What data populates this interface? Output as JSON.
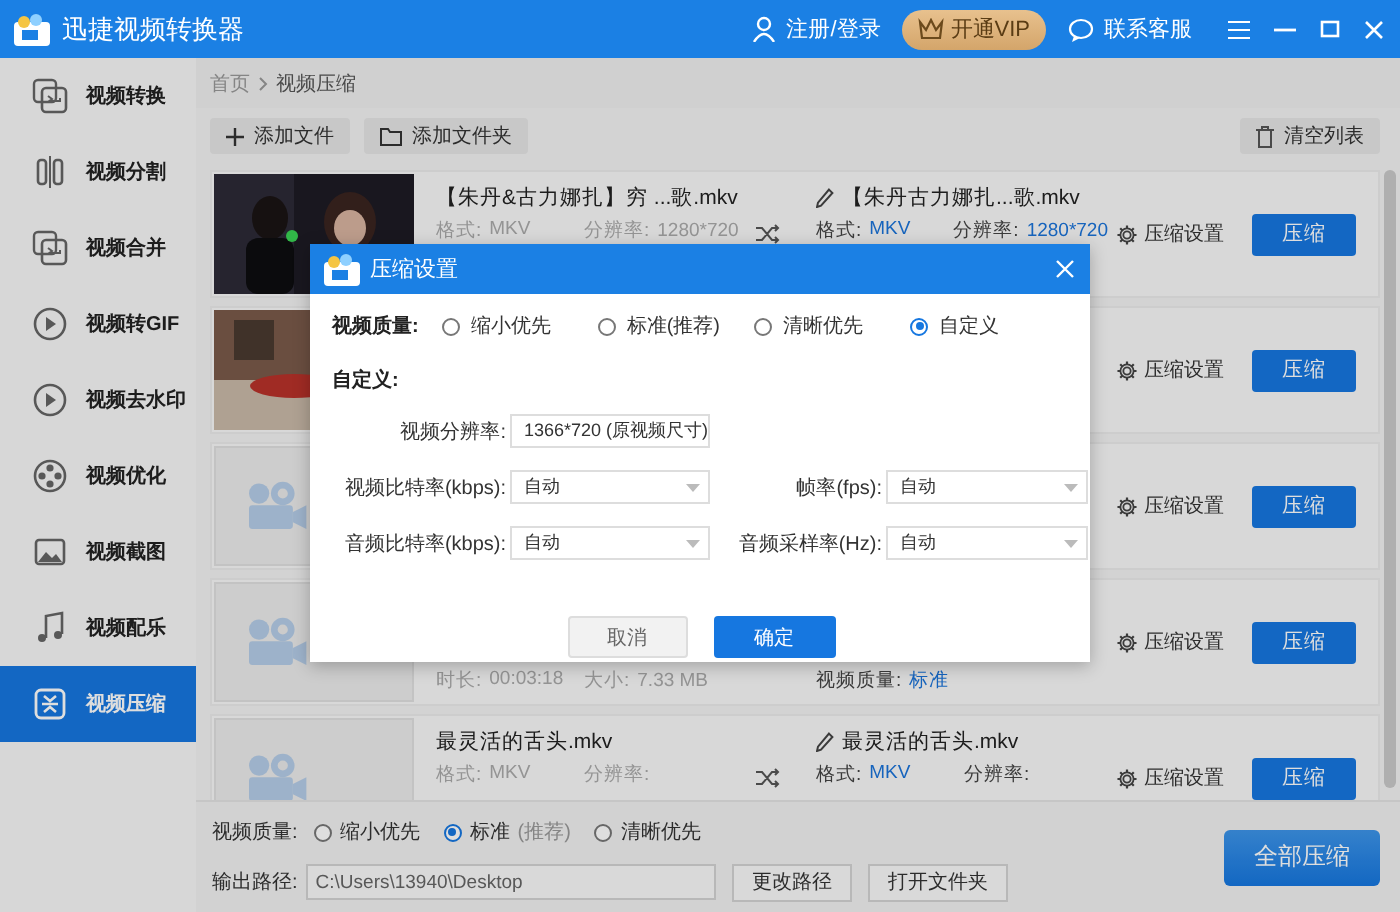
{
  "window": {
    "title": "迅捷视频转换器"
  },
  "header": {
    "login": "注册/登录",
    "vip": "开通VIP",
    "support": "联系客服"
  },
  "sidebar": {
    "items": [
      {
        "label": "视频转换",
        "selected": false
      },
      {
        "label": "视频分割",
        "selected": false
      },
      {
        "label": "视频合并",
        "selected": false
      },
      {
        "label": "视频转GIF",
        "selected": false
      },
      {
        "label": "视频去水印",
        "selected": false
      },
      {
        "label": "视频优化",
        "selected": false
      },
      {
        "label": "视频截图",
        "selected": false
      },
      {
        "label": "视频配乐",
        "selected": false
      },
      {
        "label": "视频压缩",
        "selected": true
      }
    ]
  },
  "breadcrumb": [
    "首页",
    "视频压缩"
  ],
  "toolbar": {
    "add_file": "添加文件",
    "add_folder": "添加文件夹",
    "clear": "清空列表"
  },
  "files": [
    {
      "source": {
        "name": "【朱丹&古力娜扎】穷 ...歌.mkv",
        "format_label": "格式:",
        "format": "MKV",
        "resolution_label": "分辨率:",
        "resolution": "1280*720"
      },
      "output": {
        "name": "【朱丹古力娜扎...歌.mkv",
        "format_label": "格式:",
        "format": "MKV",
        "resolution_label": "分辨率:",
        "resolution": "1280*720"
      },
      "settings": "压缩设置",
      "action": "压缩"
    },
    {
      "settings": "压缩设置",
      "action": "压缩"
    },
    {
      "thumbnail": {
        "kind": "placeholder"
      },
      "settings": "压缩设置",
      "action": "压缩"
    },
    {
      "thumbnail": {
        "kind": "placeholder"
      },
      "source": {
        "duration_label": "时长:",
        "duration": "00:03:18",
        "size_label": "大小:",
        "size": "7.33 MB"
      },
      "output": {
        "quality_label": "视频质量:",
        "quality": "标准"
      },
      "settings": "压缩设置",
      "action": "压缩"
    },
    {
      "thumbnail": {
        "kind": "placeholder"
      },
      "source": {
        "name": "最灵活的舌头.mkv",
        "format_label": "格式:",
        "format": "MKV",
        "resolution_label": "分辨率:"
      },
      "output": {
        "name": "最灵活的舌头.mkv",
        "format_label": "格式:",
        "format": "MKV",
        "resolution_label": "分辨率:"
      },
      "settings": "压缩设置",
      "action": "压缩"
    }
  ],
  "bottom": {
    "quality": {
      "label": "视频质量:",
      "options": [
        {
          "label": "缩小优先",
          "selected": false
        },
        {
          "label": "标准",
          "hint": "(推荐)",
          "selected": true
        },
        {
          "label": "清晰优先",
          "selected": false
        }
      ]
    },
    "output_path": {
      "label": "输出路径:",
      "value": "C:\\Users\\13940\\Desktop"
    },
    "change_path": "更改路径",
    "open_folder": "打开文件夹",
    "compress_all": "全部压缩"
  },
  "dialog": {
    "title": "压缩设置",
    "quality_label": "视频质量:",
    "quality_options": [
      {
        "label": "缩小优先",
        "selected": false
      },
      {
        "label": "标准(推荐)",
        "selected": false
      },
      {
        "label": "清晰优先",
        "selected": false
      },
      {
        "label": "自定义",
        "selected": true
      }
    ],
    "custom_label": "自定义:",
    "fields": [
      {
        "label": "视频分辨率:",
        "value": "1366*720 (原视频尺寸)"
      },
      {
        "label": "视频比特率(kbps):",
        "value": "自动"
      },
      {
        "label": "帧率(fps):",
        "value": "自动"
      },
      {
        "label": "音频比特率(kbps):",
        "value": "自动"
      },
      {
        "label": "音频采样率(Hz):",
        "value": "自动"
      }
    ],
    "cancel": "取消",
    "confirm": "确定"
  }
}
